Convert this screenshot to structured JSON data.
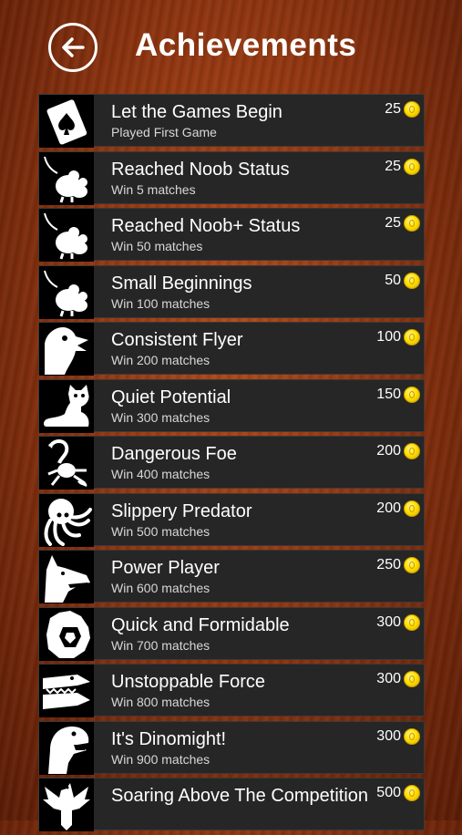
{
  "header": {
    "title": "Achievements"
  },
  "achievements": [
    {
      "name": "Let the Games Begin",
      "desc": "Played First Game",
      "reward": "25",
      "icon": "playing-card-icon"
    },
    {
      "name": "Reached Noob Status",
      "desc": "Win 5 matches",
      "reward": "25",
      "icon": "mouse-icon"
    },
    {
      "name": "Reached Noob+ Status",
      "desc": "Win 50 matches",
      "reward": "25",
      "icon": "mouse-icon"
    },
    {
      "name": "Small Beginnings",
      "desc": "Win 100 matches",
      "reward": "50",
      "icon": "mouse-icon"
    },
    {
      "name": "Consistent Flyer",
      "desc": "Win 200 matches",
      "reward": "100",
      "icon": "bird-icon"
    },
    {
      "name": "Quiet Potential",
      "desc": "Win 300 matches",
      "reward": "150",
      "icon": "cat-icon"
    },
    {
      "name": "Dangerous Foe",
      "desc": "Win 400 matches",
      "reward": "200",
      "icon": "scorpion-icon"
    },
    {
      "name": "Slippery Predator",
      "desc": "Win 500 matches",
      "reward": "200",
      "icon": "octopus-icon"
    },
    {
      "name": "Power Player",
      "desc": "Win 600 matches",
      "reward": "250",
      "icon": "wolf-icon"
    },
    {
      "name": "Quick and Formidable",
      "desc": "Win 700 matches",
      "reward": "300",
      "icon": "lion-icon"
    },
    {
      "name": "Unstoppable Force",
      "desc": "Win 800 matches",
      "reward": "300",
      "icon": "crocodile-icon"
    },
    {
      "name": "It's Dinomight!",
      "desc": "Win 900 matches",
      "reward": "300",
      "icon": "dinosaur-icon"
    },
    {
      "name": "Soaring Above The Competition",
      "desc": "",
      "reward": "500",
      "icon": "eagle-icon"
    }
  ]
}
